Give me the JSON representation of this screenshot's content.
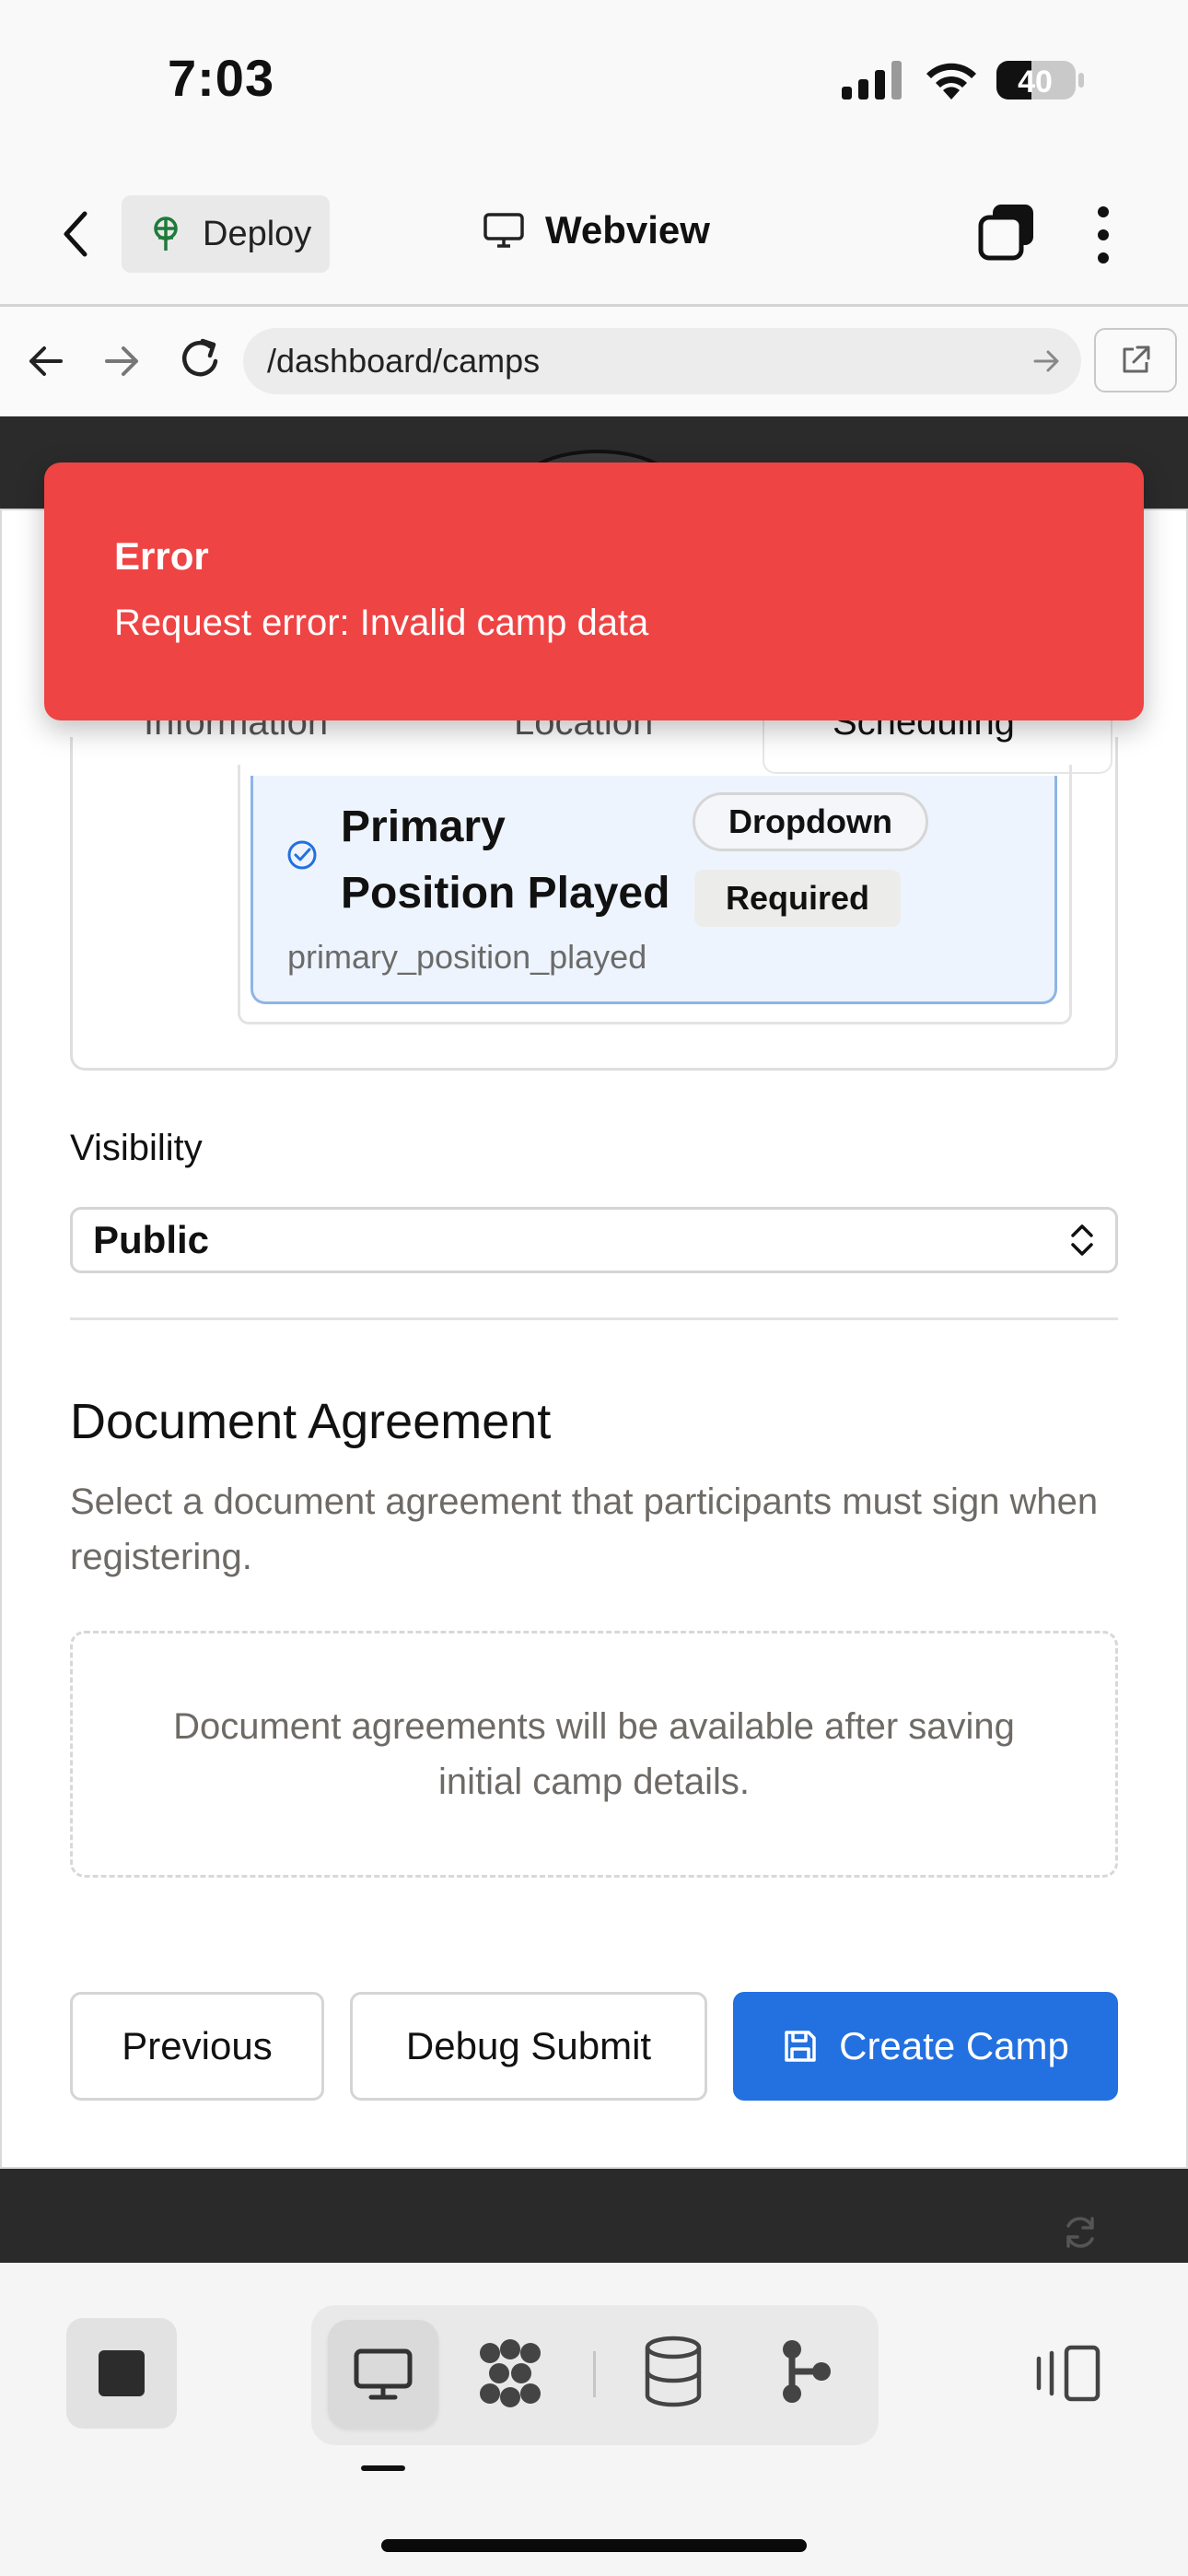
{
  "status_bar": {
    "time": "7:03",
    "battery": "40"
  },
  "app_header": {
    "deploy_label": "Deploy",
    "title": "Webview"
  },
  "browser": {
    "url": "/dashboard/camps"
  },
  "tabs": [
    "Information",
    "Location",
    "Scheduling"
  ],
  "custom_field": {
    "name": "Primary Position Played",
    "type_badge": "Dropdown",
    "required_badge": "Required",
    "key": "primary_position_played"
  },
  "visibility": {
    "label": "Visibility",
    "value": "Public"
  },
  "document_agreement": {
    "title": "Document Agreement",
    "description": "Select a document agreement that participants must sign when registering.",
    "empty_message": "Document agreements will be available after saving initial camp details."
  },
  "actions": {
    "previous": "Previous",
    "debug_submit": "Debug Submit",
    "create": "Create Camp"
  },
  "toast": {
    "title": "Error",
    "message": "Request error: Invalid camp data"
  },
  "colors": {
    "primary": "#2370e0",
    "error": "#ef4444",
    "selected_card": "#eef4fd"
  },
  "toolbar": {
    "icons": [
      "stop-icon",
      "desktop-icon",
      "agents-icon",
      "database-icon",
      "git-icon",
      "panel-icon"
    ]
  }
}
